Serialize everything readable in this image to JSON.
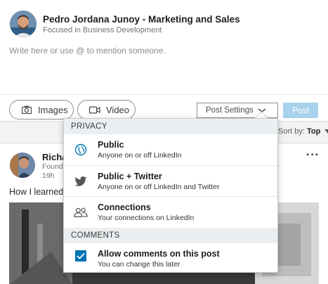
{
  "composer": {
    "author_name": "Pedro Jordana Junoy - Marketing and Sales",
    "author_headline": "Focused in Business Development",
    "placeholder": "Write here or use @ to mention someone.",
    "images_label": "Images",
    "video_label": "Video",
    "post_settings_label": "Post Settings",
    "post_label": "Post"
  },
  "sort": {
    "prefix": "Sort by:",
    "value": "Top"
  },
  "feed": {
    "author_name": "Richa",
    "author_headline": "Found",
    "time": "19h",
    "text": "How I learned t",
    "more_label": "···"
  },
  "dropdown": {
    "privacy_header": "PRIVACY",
    "options": [
      {
        "title": "Public",
        "subtitle": "Anyone on or off LinkedIn",
        "icon": "globe-icon"
      },
      {
        "title": "Public + Twitter",
        "subtitle": "Anyone on or off LinkedIn and Twitter",
        "icon": "twitter-icon"
      },
      {
        "title": "Connections",
        "subtitle": "Your connections on LinkedIn",
        "icon": "connections-icon"
      }
    ],
    "comments_header": "COMMENTS",
    "comments_option": {
      "title": "Allow comments on this post",
      "subtitle": "You can change this later",
      "checked": true
    }
  },
  "colors": {
    "accent": "#0073b1",
    "post_disabled": "#a8d2ec"
  }
}
